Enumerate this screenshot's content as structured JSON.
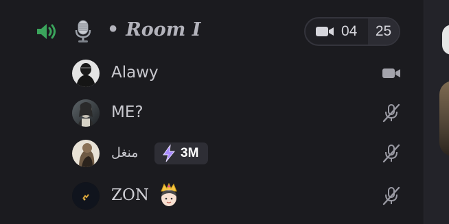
{
  "channel": {
    "speaker_icon": "speaker-volume-icon",
    "emoji_icon": "studio-microphone-emoji",
    "separator": "•",
    "name": "Room I",
    "video_icon": "video-camera-icon",
    "count_current": "04",
    "count_limit": "25"
  },
  "users": [
    {
      "name": "Alawy",
      "status_icon": "video-camera-icon"
    },
    {
      "name": "ME?",
      "status_icon": "mic-muted-icon"
    },
    {
      "name": "منغل",
      "badge_text": "3M",
      "badge_icon": "lightning-bolt-icon",
      "status_icon": "mic-muted-icon"
    },
    {
      "name": "ZON",
      "emoji": "princess-crown-emoji",
      "status_icon": "mic-muted-icon"
    }
  ],
  "colors": {
    "background": "#1b1b1f",
    "speaker_active": "#3ba55c",
    "text": "#c8c8ce",
    "icon": "#9a9aa3",
    "bolt": "#a98cff"
  }
}
